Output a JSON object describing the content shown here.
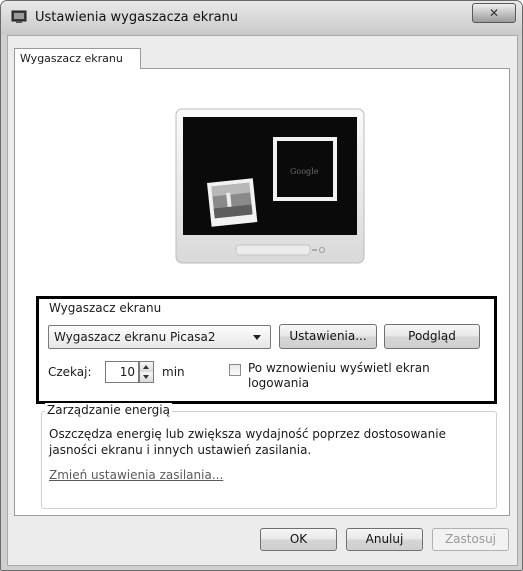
{
  "window": {
    "title": "Ustawienia wygaszacza ekranu",
    "close_label": "✕"
  },
  "tabs": [
    {
      "label": "Wygaszacz ekranu",
      "selected": true
    }
  ],
  "preview": {
    "brand_text": "Google"
  },
  "screensaver": {
    "group_label": "Wygaszacz ekranu",
    "selected": "Wygaszacz ekranu Picasa2",
    "settings_button": "Ustawienia...",
    "preview_button": "Podgląd",
    "wait_label": "Czekaj:",
    "wait_value": "10",
    "wait_unit": "min",
    "resume_logon_checkbox": "Po wznowieniu wyświetl ekran logowania",
    "resume_logon_checked": false
  },
  "power": {
    "group_label": "Zarządzanie energią",
    "description": "Oszczędza energię lub zwiększa wydajność poprzez dostosowanie jasności ekranu i innych ustawień zasilania.",
    "link": "Zmień ustawienia zasilania..."
  },
  "footer": {
    "ok": "OK",
    "cancel": "Anuluj",
    "apply": "Zastosuj",
    "apply_enabled": false
  }
}
